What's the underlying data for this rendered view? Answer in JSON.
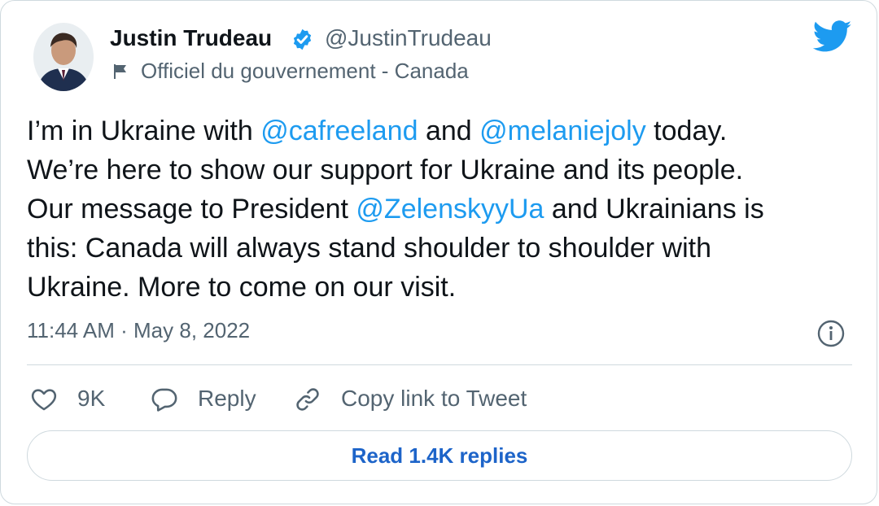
{
  "author": {
    "name": "Justin Trudeau",
    "handle": "@JustinTrudeau",
    "verified": true,
    "affiliation": "Officiel du gouvernement - Canada"
  },
  "tweet": {
    "lines": [
      [
        {
          "text": "I’m in Ukraine with ",
          "type": "text"
        },
        {
          "text": "@cafreeland",
          "type": "mention"
        },
        {
          "text": " and ",
          "type": "text"
        },
        {
          "text": "@melaniejoly",
          "type": "mention"
        },
        {
          "text": " today.",
          "type": "text"
        }
      ],
      [
        {
          "text": "We’re here to show our support for Ukraine and its people.",
          "type": "text"
        }
      ],
      [
        {
          "text": "Our message to President ",
          "type": "text"
        },
        {
          "text": "@ZelenskyyUa",
          "type": "mention"
        },
        {
          "text": " and Ukrainians is",
          "type": "text"
        }
      ],
      [
        {
          "text": "this: Canada will always stand shoulder to shoulder with",
          "type": "text"
        }
      ],
      [
        {
          "text": "Ukraine. More to come on our visit.",
          "type": "text"
        }
      ]
    ],
    "timestamp": "11:44 AM · May 8, 2022"
  },
  "actions": {
    "like_count": "9K",
    "reply_label": "Reply",
    "copy_link_label": "Copy link to Tweet"
  },
  "footer": {
    "read_replies_label": "Read 1.4K replies"
  },
  "icons": {
    "brand": "twitter-bird-icon",
    "verified": "verified-badge-icon",
    "affiliation": "flag-icon",
    "info": "info-icon",
    "like": "heart-icon",
    "reply": "speech-bubble-icon",
    "copy_link": "link-icon"
  },
  "colors": {
    "accent": "#1d9bf0",
    "link_button": "#1d64c9",
    "secondary_text": "#536471",
    "primary_text": "#0f1419",
    "border": "#cfd9de"
  }
}
